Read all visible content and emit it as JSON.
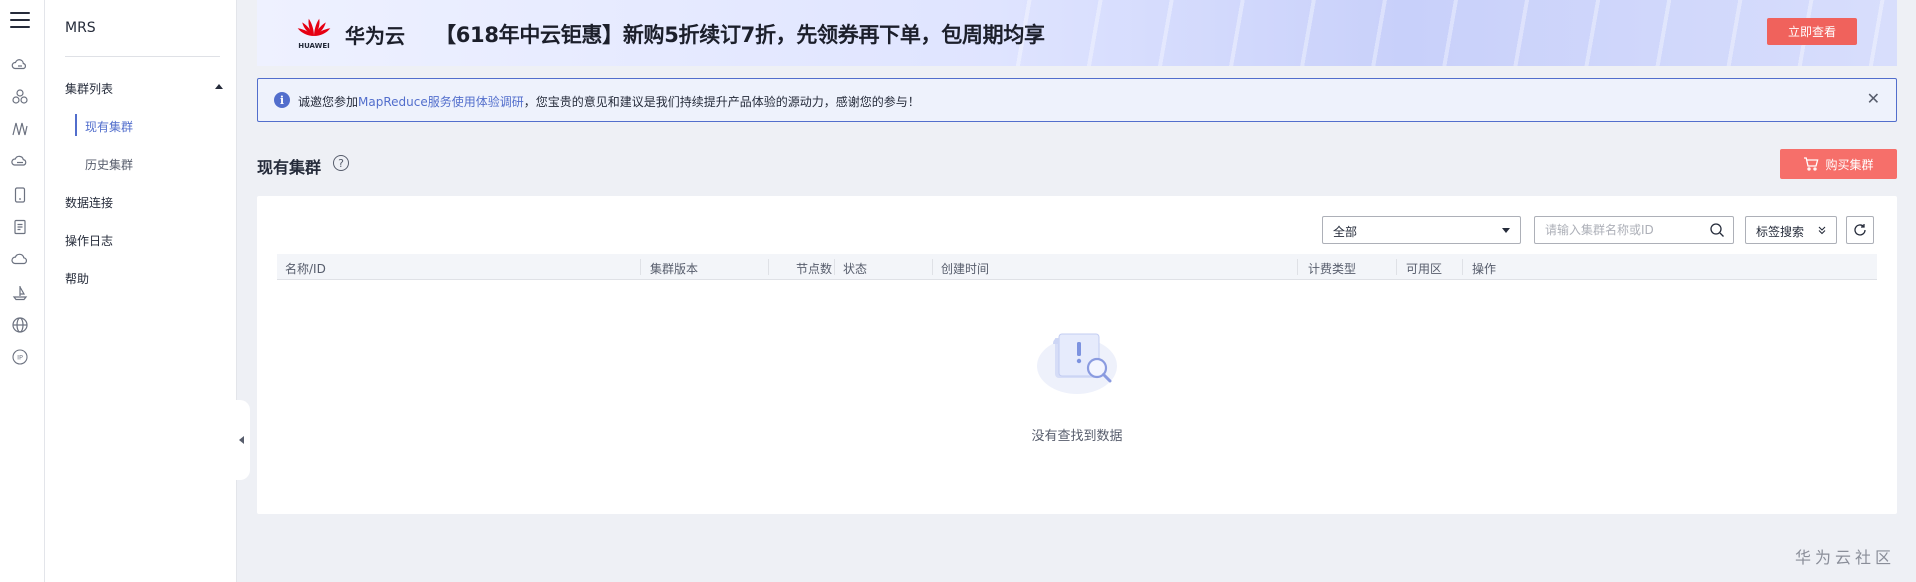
{
  "rail": {
    "icons": [
      "menu-icon",
      "cloud-server-icon",
      "cluster-icon",
      "mapreduce-icon",
      "cloud-db-icon",
      "phone-icon",
      "document-icon",
      "cloud-icon",
      "boat-icon",
      "globe-icon",
      "ip-icon"
    ]
  },
  "subnav": {
    "title": "MRS",
    "items": [
      {
        "label": "集群列表",
        "expanded": true,
        "children": [
          {
            "label": "现有集群",
            "active": true
          },
          {
            "label": "历史集群",
            "active": false
          }
        ]
      },
      {
        "label": "数据连接"
      },
      {
        "label": "操作日志"
      },
      {
        "label": "帮助"
      }
    ]
  },
  "banner": {
    "logo_word": "HUAWEI",
    "brand": "华为云",
    "headline": "【618年中云钜惠】新购5折续订7折，先领券再下单，包周期均享",
    "cta": "立即查看"
  },
  "notice": {
    "prefix": "诚邀您参加",
    "link": "MapReduce服务使用体验调研",
    "suffix": "，您宝贵的意见和建议是我们持续提升产品体验的源动力，感谢您的参与！",
    "close": "✕"
  },
  "page": {
    "title": "现有集群",
    "help": "?",
    "buy_button": "购买集群"
  },
  "toolbar": {
    "filter_value": "全部",
    "search_placeholder": "请输入集群名称或ID",
    "tag_search": "标签搜索"
  },
  "table": {
    "columns": [
      "名称/ID",
      "集群版本",
      "节点数",
      "状态",
      "创建时间",
      "计费类型",
      "可用区",
      "操作"
    ],
    "rows": [],
    "empty_text": "没有查找到数据"
  },
  "watermark": "华为云社区",
  "colors": {
    "accent": "#526ecc",
    "cta": "#f0625c",
    "buy": "#f66f6a",
    "background": "#eef0f5"
  }
}
